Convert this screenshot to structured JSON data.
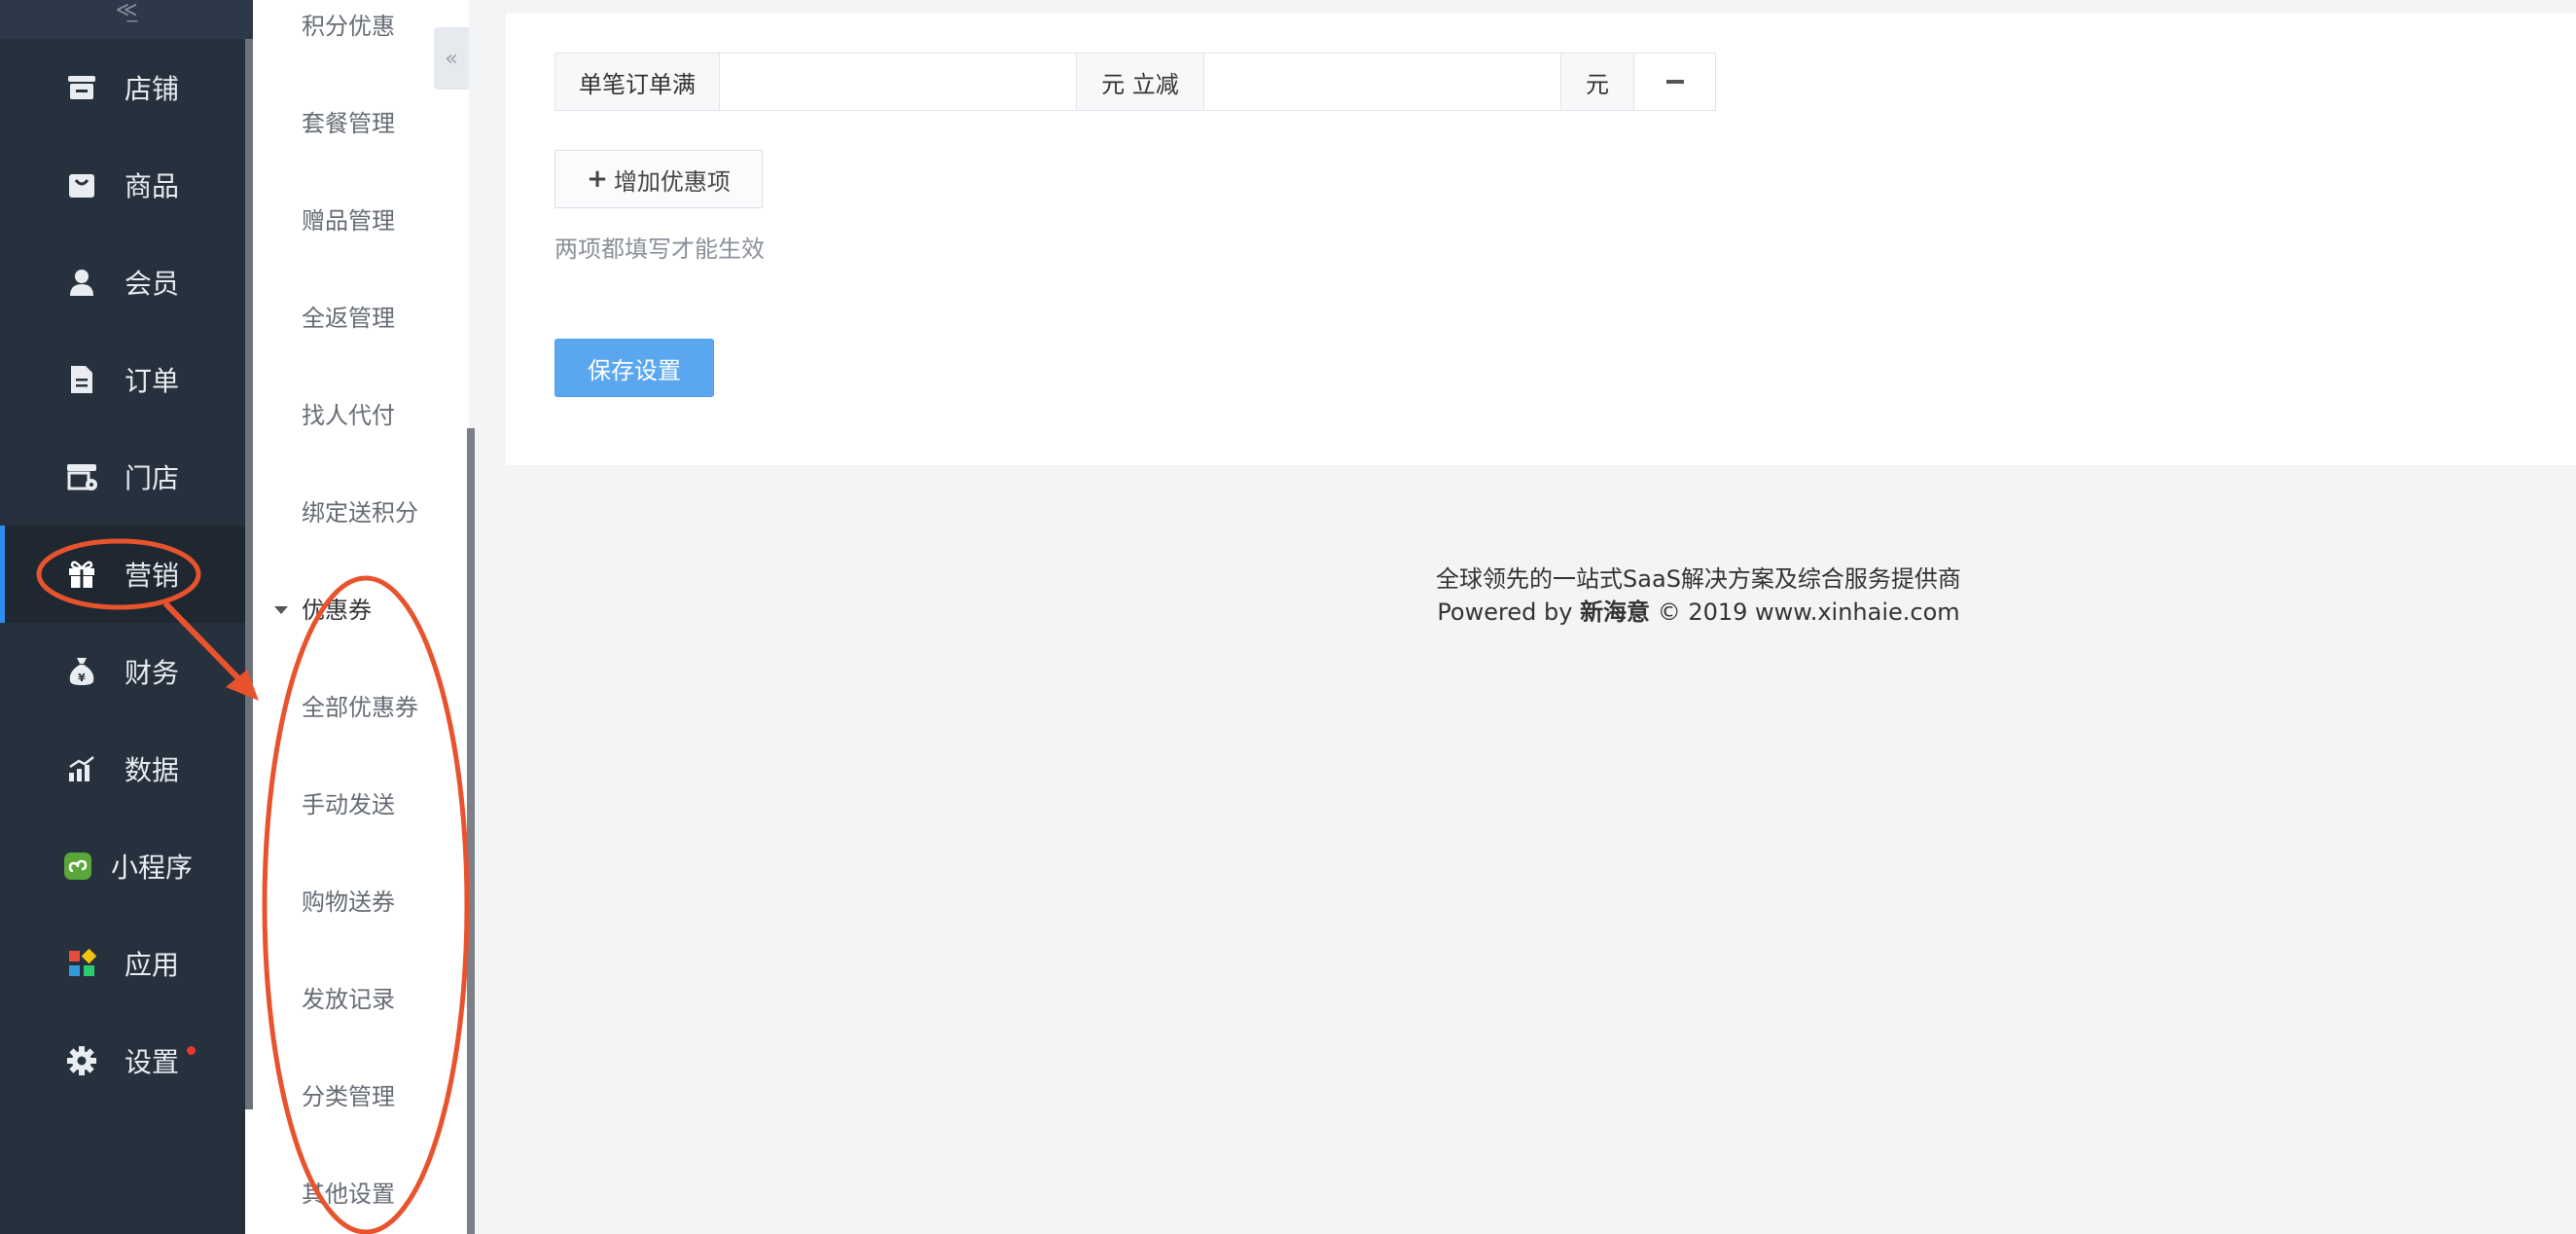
{
  "sidebar": {
    "items": [
      {
        "label": "店铺",
        "icon": "store-icon"
      },
      {
        "label": "商品",
        "icon": "bag-icon"
      },
      {
        "label": "会员",
        "icon": "user-icon"
      },
      {
        "label": "订单",
        "icon": "document-icon"
      },
      {
        "label": "门店",
        "icon": "shop-front-icon"
      },
      {
        "label": "营销",
        "icon": "gift-icon",
        "active": true
      },
      {
        "label": "财务",
        "icon": "money-bag-icon"
      },
      {
        "label": "数据",
        "icon": "chart-icon"
      },
      {
        "label": "小程序",
        "icon": "mini-program-icon"
      },
      {
        "label": "应用",
        "icon": "apps-grid-icon"
      },
      {
        "label": "设置",
        "icon": "gear-icon",
        "has_notification_dot": true
      }
    ],
    "active_color": "#2f8cf0",
    "bg_color": "#27313d"
  },
  "submenu": {
    "items": [
      "积分优惠",
      "套餐管理",
      "赠品管理",
      "全返管理",
      "找人代付",
      "绑定送积分"
    ],
    "group": {
      "label": "优惠券",
      "expanded": true,
      "items": [
        "全部优惠券",
        "手动发送",
        "购物送券",
        "发放记录",
        "分类管理",
        "其他设置"
      ]
    }
  },
  "form": {
    "rule_prefix": "单笔订单满",
    "rule_middle": "元 立减",
    "rule_suffix": "元",
    "amount_value": "",
    "discount_value": "",
    "add_button": "增加优惠项",
    "hint": "两项都填写才能生效",
    "save_button": "保存设置"
  },
  "footer": {
    "tagline": "全球领先的一站式SaaS解决方案及综合服务提供商",
    "powered_prefix": "Powered by",
    "brand": "新海意",
    "copyright": "© 2019 www.xinhaie.com"
  },
  "colors": {
    "annotation": "#e8532e",
    "primary_button": "#5aa7f0"
  }
}
